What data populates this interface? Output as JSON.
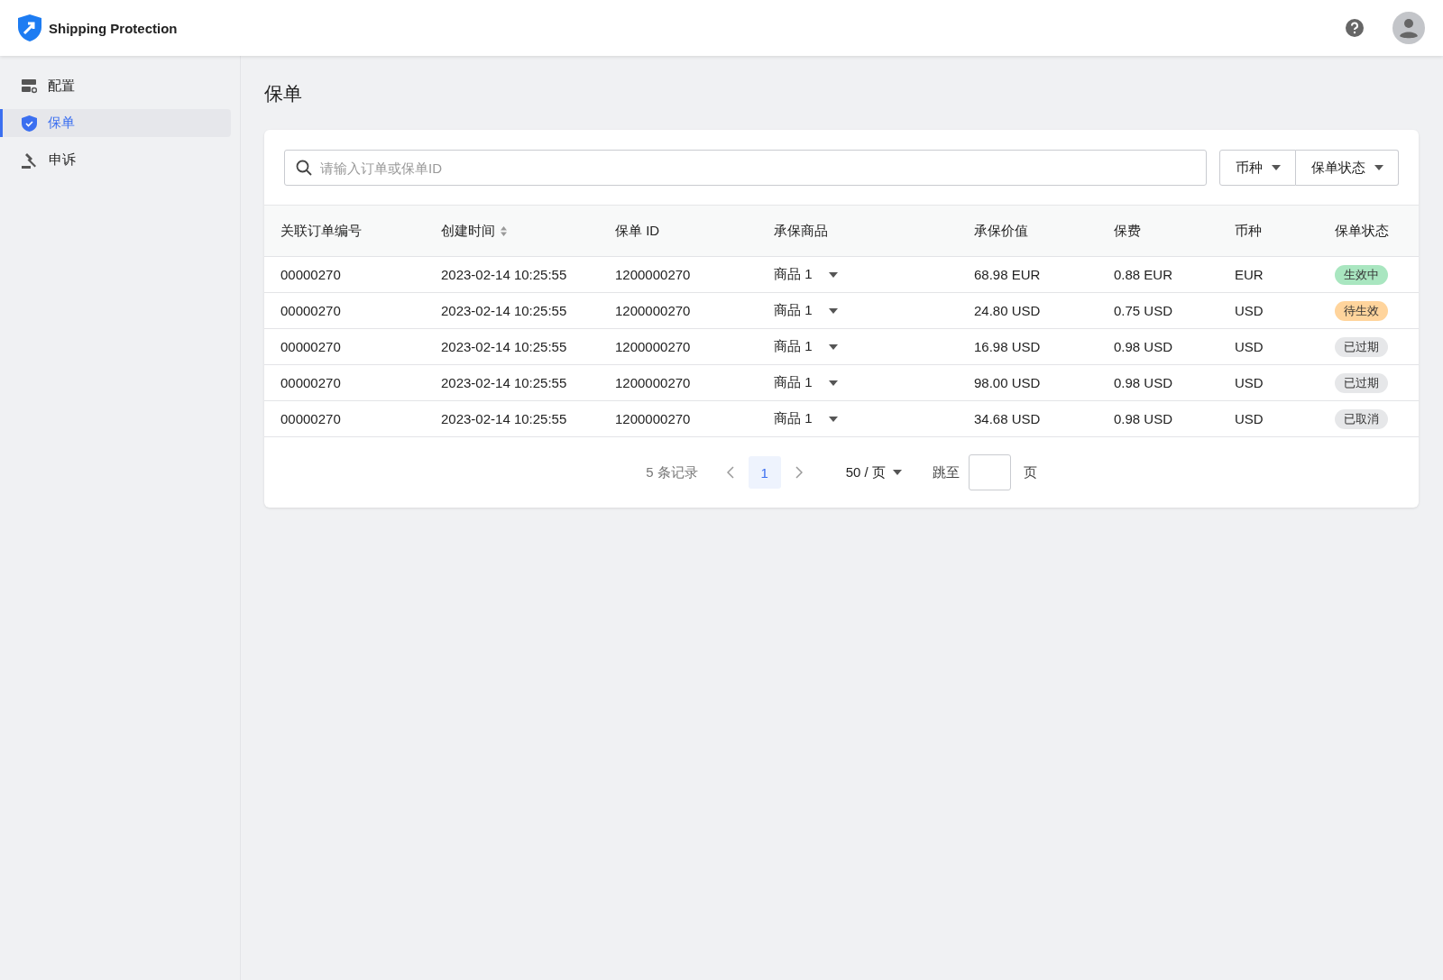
{
  "header": {
    "app_name": "Shipping Protection"
  },
  "sidebar": {
    "items": [
      {
        "label": "配置",
        "selected": false
      },
      {
        "label": "保单",
        "selected": true
      },
      {
        "label": "申诉",
        "selected": false
      }
    ]
  },
  "page_title": "保单",
  "search": {
    "placeholder": "请输入订单或保单ID"
  },
  "filters": [
    "币种",
    "保单状态"
  ],
  "table": {
    "columns": [
      {
        "label": "关联订单编号",
        "sortable": false
      },
      {
        "label": "创建时间",
        "sortable": true
      },
      {
        "label": "保单 ID",
        "sortable": false
      },
      {
        "label": "承保商品",
        "sortable": false
      },
      {
        "label": "承保价值",
        "sortable": false
      },
      {
        "label": "保费",
        "sortable": false
      },
      {
        "label": "币种",
        "sortable": false
      },
      {
        "label": "保单状态",
        "sortable": false
      }
    ],
    "rows": [
      {
        "order": "00000270",
        "created": "2023-02-14 10:25:55",
        "policy_id": "1200000270",
        "product": "商品 1",
        "value": "68.98 EUR",
        "premium": "0.88 EUR",
        "currency": "EUR",
        "status": {
          "label": "生效中",
          "color": "#a9e6c0"
        }
      },
      {
        "order": "00000270",
        "created": "2023-02-14 10:25:55",
        "policy_id": "1200000270",
        "product": "商品 1",
        "value": "24.80 USD",
        "premium": "0.75 USD",
        "currency": "USD",
        "status": {
          "label": "待生效",
          "color": "#ffd49c"
        }
      },
      {
        "order": "00000270",
        "created": "2023-02-14 10:25:55",
        "policy_id": "1200000270",
        "product": "商品 1",
        "value": "16.98 USD",
        "premium": "0.98 USD",
        "currency": "USD",
        "status": {
          "label": "已过期",
          "color": "#e6e7e9"
        }
      },
      {
        "order": "00000270",
        "created": "2023-02-14 10:25:55",
        "policy_id": "1200000270",
        "product": "商品 1",
        "value": "98.00 USD",
        "premium": "0.98 USD",
        "currency": "USD",
        "status": {
          "label": "已过期",
          "color": "#e6e7e9"
        }
      },
      {
        "order": "00000270",
        "created": "2023-02-14 10:25:55",
        "policy_id": "1200000270",
        "product": "商品 1",
        "value": "34.68 USD",
        "premium": "0.98 USD",
        "currency": "USD",
        "status": {
          "label": "已取消",
          "color": "#e6e7e9"
        }
      }
    ]
  },
  "pagination": {
    "total": "5 条记录",
    "pages": [
      {
        "label": "1",
        "selected": true
      }
    ],
    "page_size": "50 / 页",
    "jump_label": "跳至",
    "jump_suffix": "页"
  }
}
